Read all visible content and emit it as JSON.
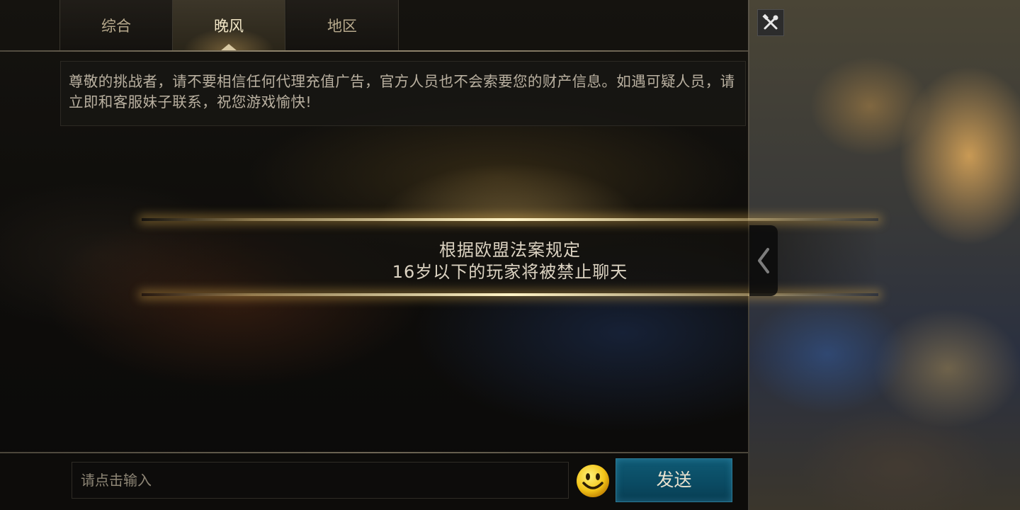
{
  "tabs": [
    {
      "label": "综合",
      "active": false
    },
    {
      "label": "晚风",
      "active": true
    },
    {
      "label": "地区",
      "active": false
    }
  ],
  "notice": {
    "text": "尊敬的挑战者，请不要相信任何代理充值广告，官方人员也不会索要您的财产信息。如遇可疑人员，请立即和客服妹子联系，祝您游戏愉快!"
  },
  "ban_banner": {
    "line1": "根据欧盟法案规定",
    "line2": "16岁以下的玩家将被禁止聊天"
  },
  "input": {
    "placeholder": "请点击输入",
    "value": ""
  },
  "buttons": {
    "send_label": "发送"
  },
  "icons": {
    "tools": "tools-icon",
    "emoji": "emoji-icon",
    "collapse": "chevron-left-icon"
  },
  "colors": {
    "accent_gold": "#d9c9a3",
    "send_blue": "#0f5a74"
  }
}
